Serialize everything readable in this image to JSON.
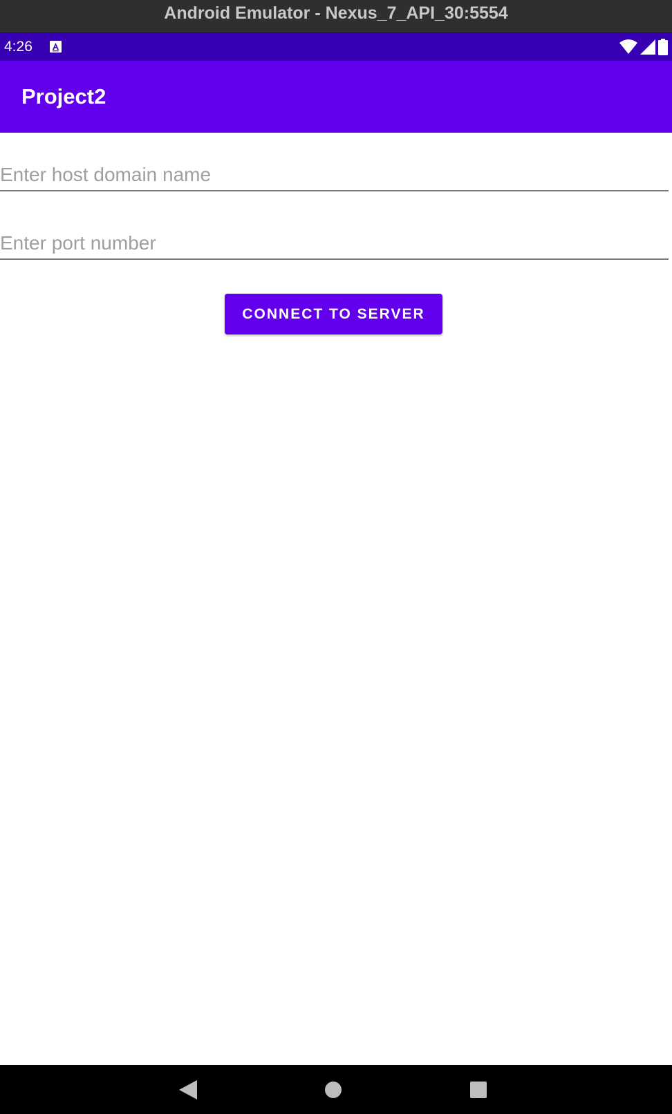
{
  "window": {
    "title": "Android Emulator - Nexus_7_API_30:5554"
  },
  "status_bar": {
    "time": "4:26",
    "icons": [
      "notification-a-icon",
      "wifi-icon",
      "signal-icon",
      "battery-icon"
    ],
    "color": "#3700b3"
  },
  "app_bar": {
    "title": "Project2",
    "color": "#6200ee"
  },
  "form": {
    "host_field": {
      "placeholder": "Enter host domain name",
      "value": ""
    },
    "port_field": {
      "placeholder": "Enter port number",
      "value": ""
    },
    "connect_button_label": "CONNECT TO SERVER"
  },
  "nav_bar": {
    "buttons": [
      "back-icon",
      "home-icon",
      "recents-icon"
    ]
  }
}
